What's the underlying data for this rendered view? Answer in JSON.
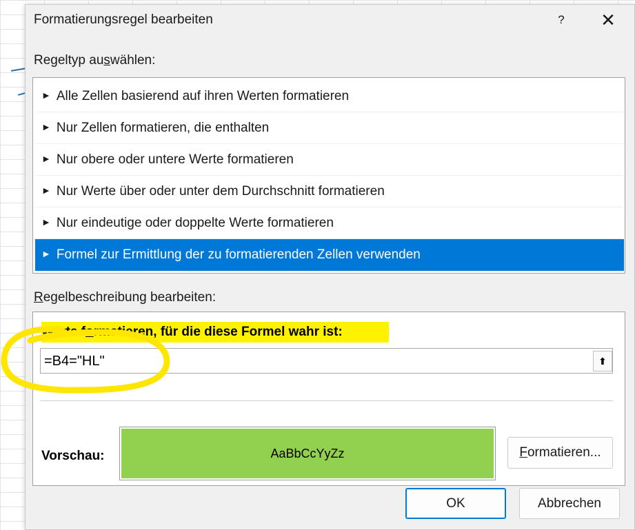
{
  "dialog": {
    "title": "Formatierungsregel bearbeiten",
    "help_label": "?",
    "close_label": "✕"
  },
  "rule_type": {
    "heading_pre": "Regeltyp au",
    "heading_accel": "s",
    "heading_post": "wählen:",
    "items": [
      {
        "label": "Alle Zellen basierend auf ihren Werten formatieren",
        "selected": false
      },
      {
        "label": "Nur Zellen formatieren, die enthalten",
        "selected": false
      },
      {
        "label": "Nur obere oder untere Werte formatieren",
        "selected": false
      },
      {
        "label": "Nur Werte über oder unter dem Durchschnitt formatieren",
        "selected": false
      },
      {
        "label": "Nur eindeutige oder doppelte Werte formatieren",
        "selected": false
      },
      {
        "label": "Formel zur Ermittlung der zu formatierenden Zellen verwenden",
        "selected": true
      }
    ],
    "bullet": "►"
  },
  "description": {
    "heading_accel": "R",
    "heading_post": "egelbeschreibung bearbeiten:",
    "formula_label_pre": "Werte f",
    "formula_label_accel": "o",
    "formula_label_post": "rmatieren, für die diese Formel wahr ist:",
    "formula_value": "=B4=\"HL\"",
    "collapse_icon": "🠅",
    "preview_label": "Vorschau:",
    "preview_text": "AaBbCcYyZz",
    "preview_fill": "#92d050",
    "format_button_accel": "F",
    "format_button_post": "ormatieren..."
  },
  "footer": {
    "ok_label": "OK",
    "cancel_label": "Abbrechen"
  },
  "colors": {
    "selection": "#0078d7",
    "highlight": "#fff200",
    "annotation": "#ffe600"
  }
}
